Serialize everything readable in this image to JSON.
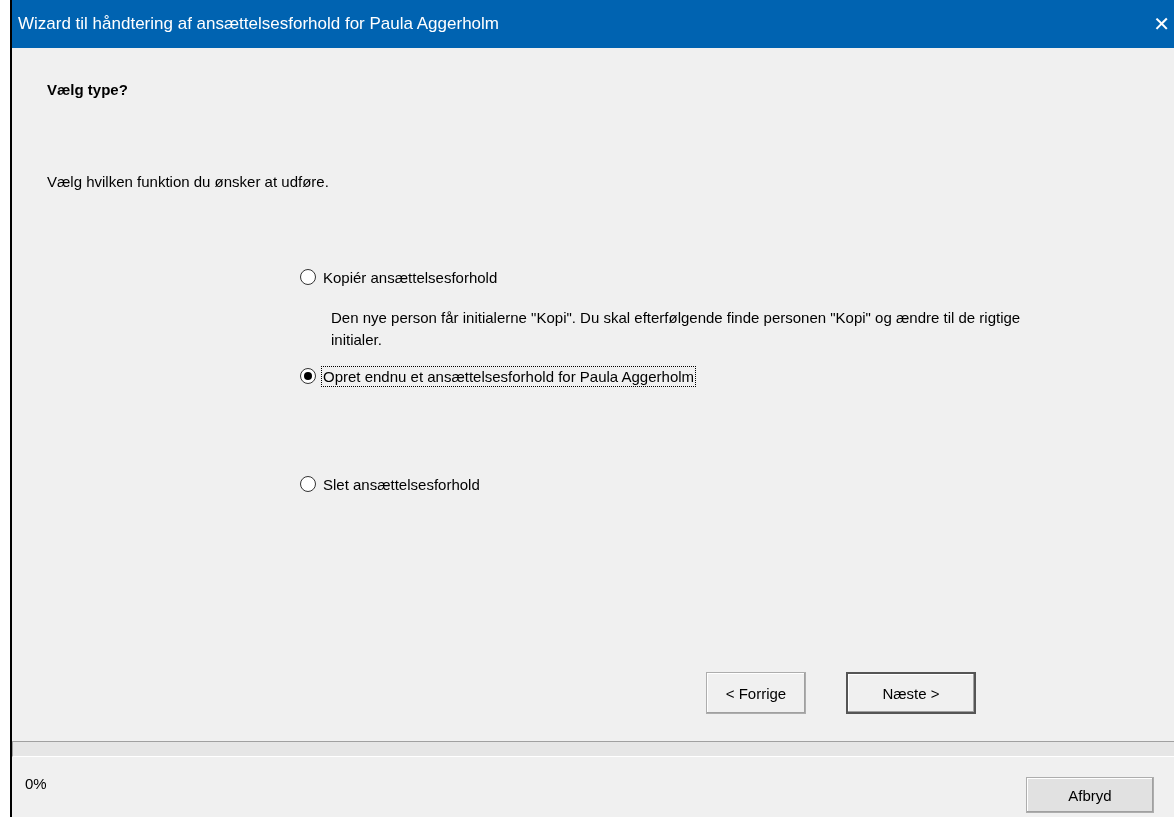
{
  "window": {
    "title": "Wizard til håndtering af ansættelsesforhold for Paula Aggerholm",
    "close": "✕"
  },
  "heading": "Vælg type?",
  "instruction": "Vælg hvilken funktion du ønsker at udføre.",
  "options": [
    {
      "label": "Kopiér ansættelsesforhold",
      "selected": false,
      "description": "Den nye person får initialerne \"Kopi\". Du skal efterfølgende finde personen \"Kopi\" og ændre til de rigtige initialer."
    },
    {
      "label": "Opret endnu et ansættelsesforhold for Paula Aggerholm",
      "selected": true
    },
    {
      "label": "Slet ansættelsesforhold",
      "selected": false
    }
  ],
  "nav_buttons": [
    {
      "label": "< Forrige",
      "default": false
    },
    {
      "label": "Næste >",
      "default": true
    }
  ],
  "progress": {
    "level": 0,
    "reading": "0%"
  },
  "cancel_button": "Afbryd"
}
